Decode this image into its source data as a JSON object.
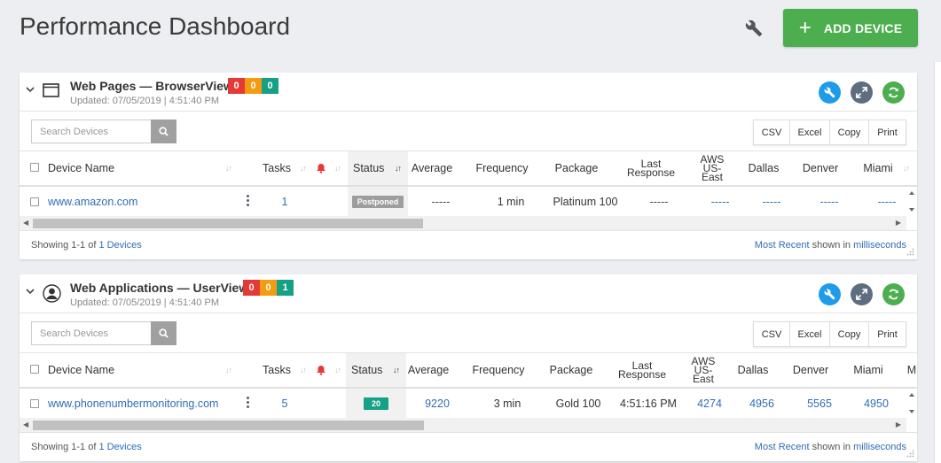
{
  "page": {
    "title": "Performance Dashboard",
    "add_device_label": "ADD DEVICE"
  },
  "colors": {
    "add_button": "#4cae4f",
    "badge_red": "#e53935",
    "badge_orange": "#f39c12",
    "badge_green": "#16a085",
    "link": "#2f6db5",
    "action_blue": "#1e9be9",
    "action_gray": "#5d6e80"
  },
  "columns": {
    "device_name": "Device Name",
    "tasks": "Tasks",
    "status": "Status",
    "average": "Average",
    "frequency": "Frequency",
    "package": "Package",
    "last_response_1": "Last",
    "last_response_2": "Response",
    "aws_1": "AWS",
    "aws_2": "US-",
    "aws_3": "East",
    "dallas": "Dallas",
    "denver": "Denver",
    "miami": "Miami",
    "overflow_col": "M"
  },
  "export": {
    "csv": "CSV",
    "excel": "Excel",
    "copy": "Copy",
    "print": "Print"
  },
  "panels": [
    {
      "title": "Web Pages — BrowserView",
      "icon": "browser-window-icon",
      "updated": "Updated: 07/05/2019 | 4:51:40 PM",
      "badges": [
        "0",
        "0",
        "0"
      ],
      "search_placeholder": "Search Devices",
      "row": {
        "device": "www.amazon.com",
        "tasks": "1",
        "status": "Postponed",
        "average": "-----",
        "frequency": "1 min",
        "package": "Platinum 100",
        "last_response": "-----",
        "aws": "-----",
        "dallas": "-----",
        "denver": "-----",
        "miami": "-----"
      },
      "footer": {
        "showing": "Showing 1-1 of ",
        "devices_link": "1 Devices",
        "most_recent": "Most Recent",
        "shown_in": " shown in ",
        "unit": "milliseconds"
      }
    },
    {
      "title": "Web Applications — UserView",
      "icon": "user-avatar-icon",
      "updated": "Updated: 07/05/2019 | 4:51:40 PM",
      "badges": [
        "0",
        "0",
        "1"
      ],
      "search_placeholder": "Search Devices",
      "row": {
        "device": "www.phonenumbermonitoring.com",
        "tasks": "5",
        "status": "20",
        "average": "9220",
        "frequency": "3 min",
        "package": "Gold 100",
        "last_response": "4:51:16 PM",
        "aws": "4274",
        "dallas": "4956",
        "denver": "5565",
        "miami": "4950"
      },
      "footer": {
        "showing": "Showing 1-1 of ",
        "devices_link": "1 Devices",
        "most_recent": "Most Recent",
        "shown_in": " shown in ",
        "unit": "milliseconds"
      }
    }
  ]
}
